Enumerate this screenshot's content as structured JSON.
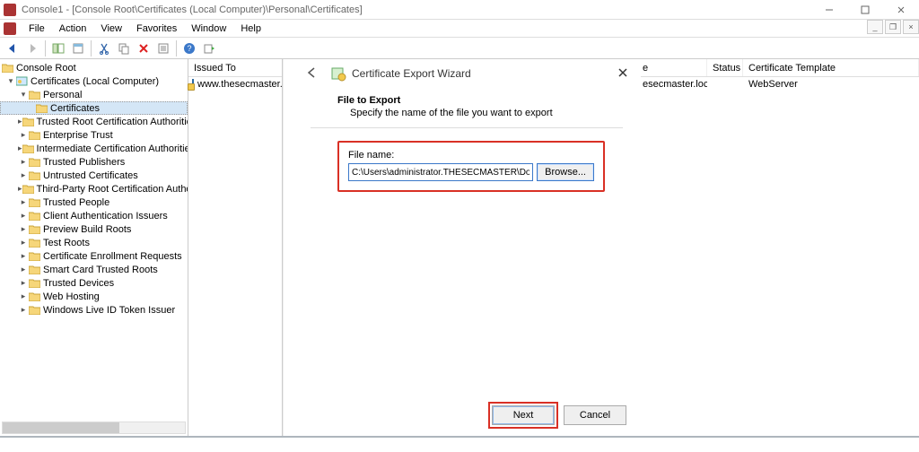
{
  "titlebar": {
    "text": "Console1 - [Console Root\\Certificates (Local Computer)\\Personal\\Certificates]"
  },
  "menu": {
    "file": "File",
    "action": "Action",
    "view": "View",
    "favorites": "Favorites",
    "window": "Window",
    "help": "Help"
  },
  "tree": {
    "root": "Console Root",
    "certs": "Certificates (Local Computer)",
    "personal": "Personal",
    "certificates": "Certificates",
    "items": [
      "Trusted Root Certification Authorities",
      "Enterprise Trust",
      "Intermediate Certification Authorities",
      "Trusted Publishers",
      "Untrusted Certificates",
      "Third-Party Root Certification Authoritie",
      "Trusted People",
      "Client Authentication Issuers",
      "Preview Build Roots",
      "Test Roots",
      "Certificate Enrollment Requests",
      "Smart Card Trusted Roots",
      "Trusted Devices",
      "Web Hosting",
      "Windows Live ID Token Issuer"
    ]
  },
  "list": {
    "header": "Issued To",
    "row": "www.thesecmaster.l"
  },
  "columns": {
    "col_e": "e",
    "status": "Status",
    "template": "Certificate Template"
  },
  "data_row": {
    "col_e_val": "esecmaster.local",
    "status_val": "",
    "template_val": "WebServer"
  },
  "wizard": {
    "title": "Certificate Export Wizard",
    "section_title": "File to Export",
    "section_desc": "Specify the name of the file you want to export",
    "file_label": "File name:",
    "file_value": "C:\\Users\\administrator.THESECMASTER\\Documents\\WWW_Cert.pfx",
    "browse": "Browse...",
    "next": "Next",
    "cancel": "Cancel"
  }
}
